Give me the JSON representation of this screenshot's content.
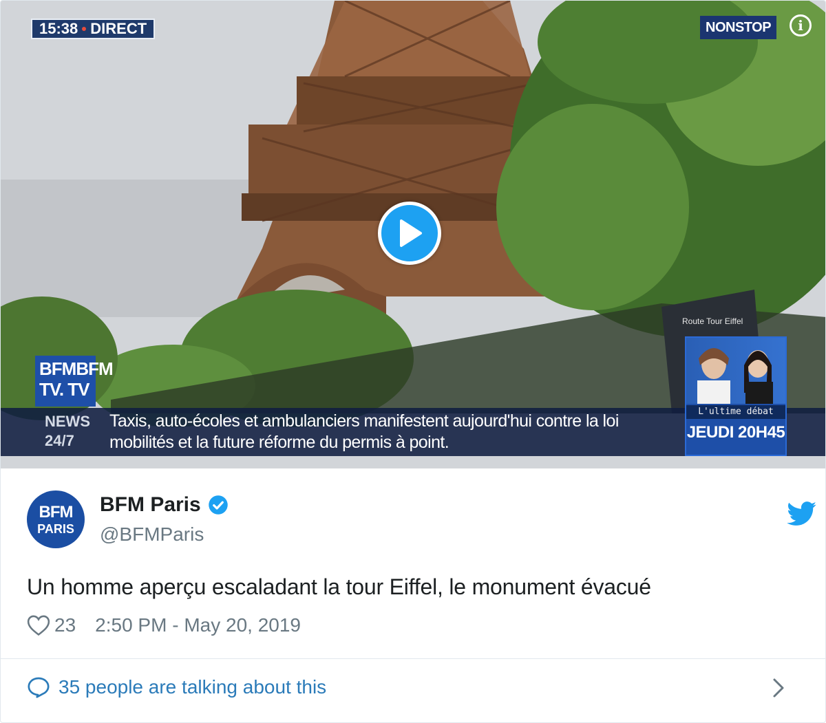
{
  "video": {
    "live_time": "15:38",
    "live_label": "DIRECT",
    "channel_badge": "NONSTOP",
    "info_icon": "info-icon",
    "play_icon": "play-icon",
    "channel_logo_line1": "BFMBFM",
    "channel_logo_line2": "TV. TV",
    "ticker_label_line1": "NEWS",
    "ticker_label_line2": "24/7",
    "ticker_text": "Taxis, auto-écoles et ambulanciers manifestent aujourd'hui contre la loi mobilités et la future réforme du permis à point.",
    "promo_subtitle": "L'ultime débat",
    "promo_time": "JEUDI 20H45",
    "sign_text": "Route Tour Eiffel"
  },
  "tweet": {
    "avatar_line1": "BFM",
    "avatar_line2": "PARIS",
    "author_name": "BFM Paris",
    "handle": "@BFMParis",
    "text": "Un homme aperçu escaladant la tour Eiffel, le monument évacué",
    "likes": "23",
    "timestamp": "2:50 PM - May 20, 2019",
    "talking": "35 people are talking about this"
  },
  "colors": {
    "twitter_blue": "#1da1f2",
    "link_blue": "#2b7bb9",
    "muted": "#697882",
    "bfm_blue": "#1b4ea3"
  }
}
